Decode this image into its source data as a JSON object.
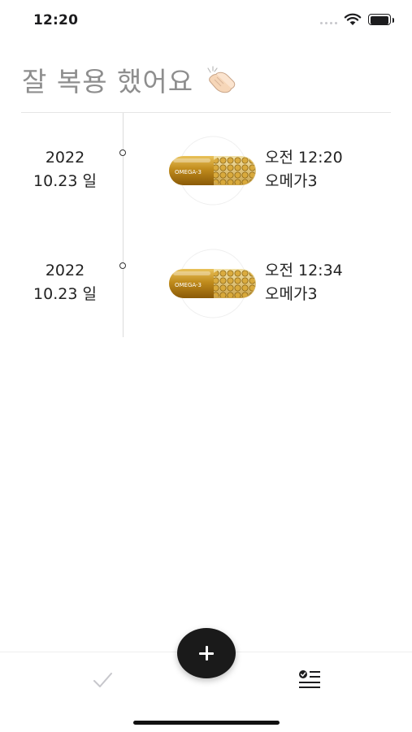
{
  "status_bar": {
    "time": "12:20",
    "icons": [
      "cellular-signal-icon",
      "wifi-icon",
      "battery-icon"
    ]
  },
  "header": {
    "title": "잘 복용 했어요",
    "title_icon": "clapping-hands-icon"
  },
  "history": [
    {
      "year": "2022",
      "day": "10.23 일",
      "time": "오전 12:20",
      "name": "오메가3",
      "pill_label": "OMEGA-3"
    },
    {
      "year": "2022",
      "day": "10.23 일",
      "time": "오전 12:34",
      "name": "오메가3",
      "pill_label": "OMEGA-3"
    }
  ],
  "fab": {
    "icon": "plus-icon"
  },
  "tab_bar": {
    "tabs": [
      {
        "id": "check",
        "icon": "checkmark-icon",
        "active": false
      },
      {
        "id": "history",
        "icon": "checklist-icon",
        "active": true
      }
    ]
  },
  "colors": {
    "title": "#8e8e8e",
    "fab": "#1a1a1a",
    "inactive_tab": "#c7c7cc",
    "active_tab": "#1c1c1e",
    "capsule": "#b8860b"
  }
}
